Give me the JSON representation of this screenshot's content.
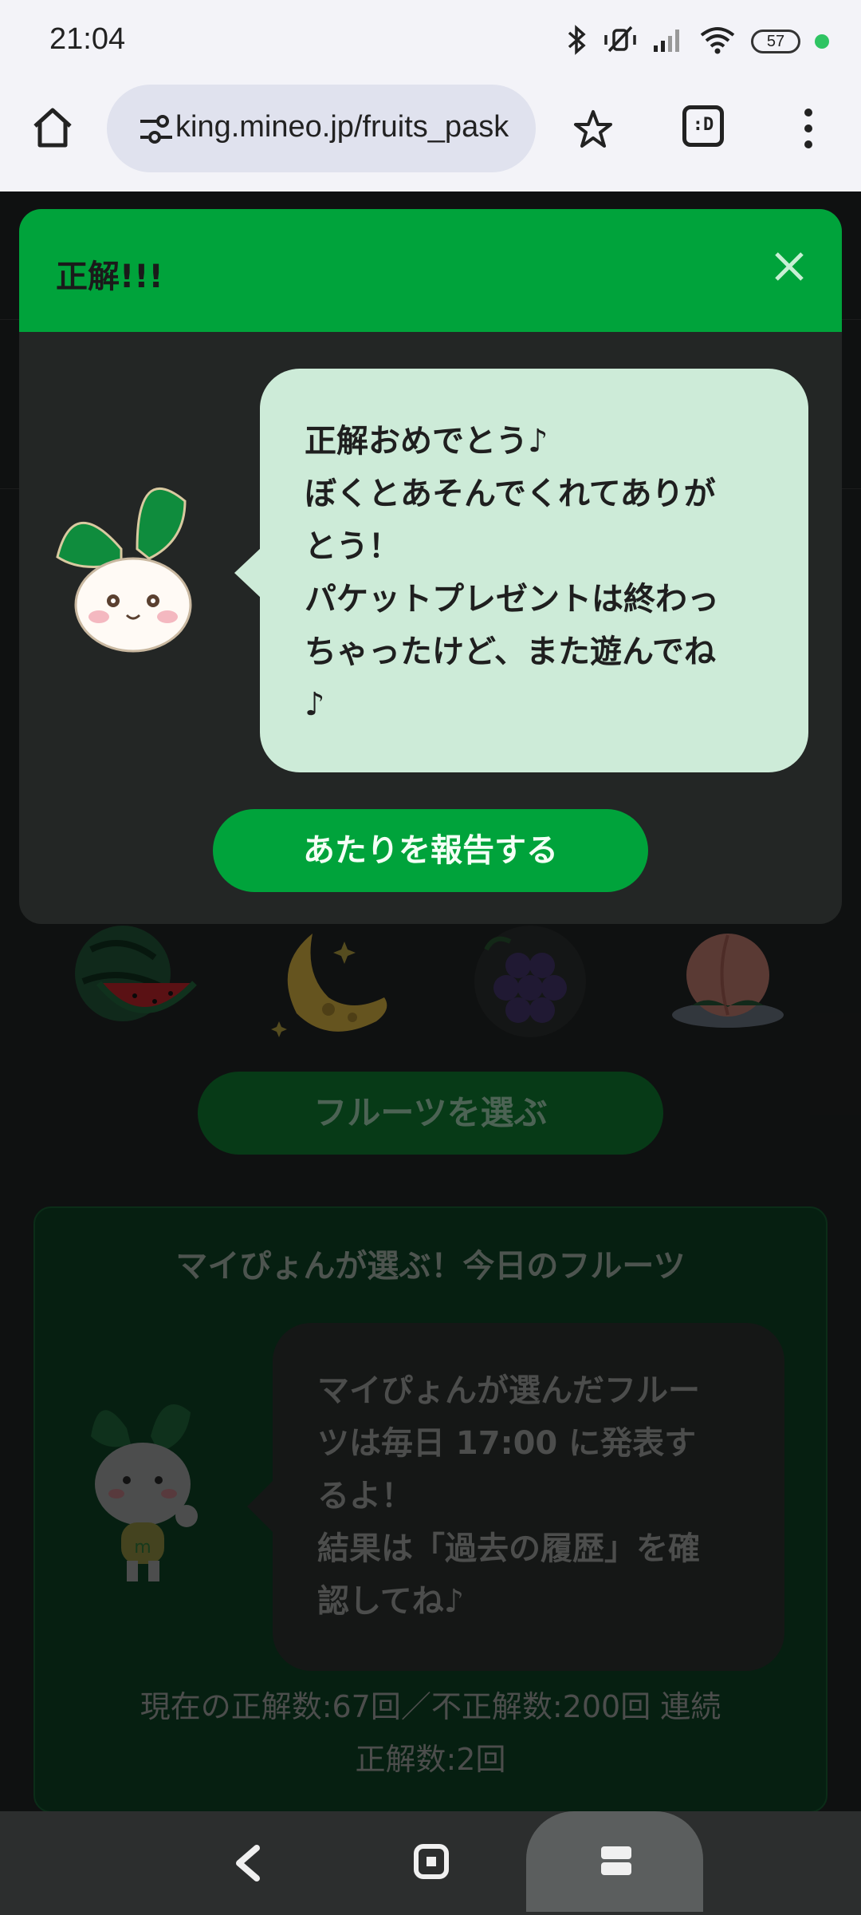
{
  "status_bar": {
    "time": "21:04",
    "battery": "57",
    "icons": [
      "bluetooth-icon",
      "mute-icon",
      "signal-icon",
      "wifi-icon",
      "battery-icon",
      "notification-dot"
    ]
  },
  "browser": {
    "url": "king.mineo.jp/fruits_pask",
    "ext_label": ":D"
  },
  "modal": {
    "title": "正解!!!",
    "bubble_lines": [
      "正解おめでとう♪",
      "ぼくとあそんでくれてありが",
      "とう！",
      "パケットプレゼントは終わっ",
      "ちゃったけど、また遊んでね",
      "♪"
    ],
    "report_button": "あたりを報告する"
  },
  "page": {
    "fruits": [
      "watermelon",
      "cheese-moon",
      "grapes",
      "peach"
    ],
    "choose_button": "フルーツを選ぶ",
    "today": {
      "title": "マイぴょんが選ぶ！今日のフルーツ",
      "bubble_lines": [
        "マイぴょんが選んだフルー",
        "ツは毎日 17:00 に発表す",
        "るよ！",
        "結果は「過去の履歴」を確",
        "認してね♪"
      ],
      "stats_line1": "現在の正解数:67回／不正解数:200回 連続",
      "stats_line2": "正解数:2回"
    }
  },
  "colors": {
    "accent_green": "#00a33b",
    "bubble_green": "#cdebd8",
    "modal_bg": "#232625"
  }
}
